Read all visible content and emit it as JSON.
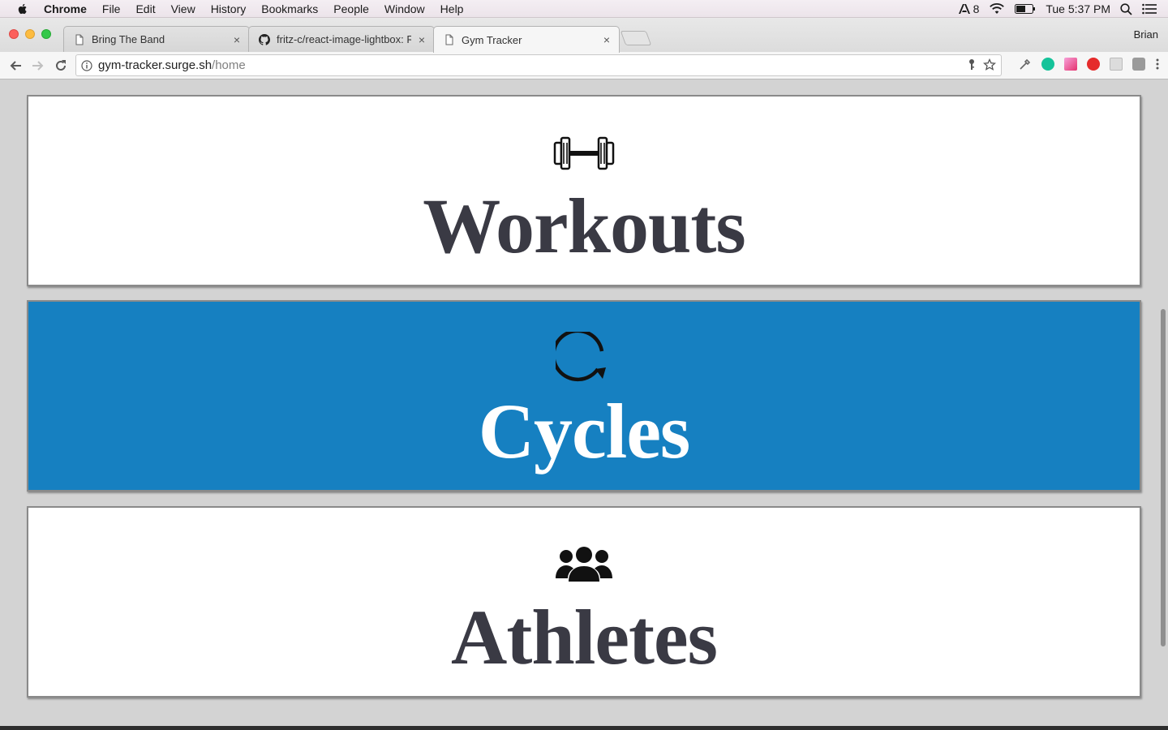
{
  "menubar": {
    "app_name": "Chrome",
    "items": [
      "File",
      "Edit",
      "View",
      "History",
      "Bookmarks",
      "People",
      "Window",
      "Help"
    ],
    "status": {
      "adobe_count": "8",
      "clock": "Tue 5:37 PM"
    }
  },
  "browser": {
    "profile_name": "Brian",
    "tabs": [
      {
        "title": "Bring The Band",
        "icon": "page-icon",
        "active": false
      },
      {
        "title": "fritz-c/react-image-lightbox: R",
        "icon": "github-icon",
        "active": false
      },
      {
        "title": "Gym Tracker",
        "icon": "page-icon",
        "active": true
      }
    ],
    "address": {
      "host": "gym-tracker.surge.sh",
      "path": "/home"
    }
  },
  "page": {
    "cards": [
      {
        "label": "Workouts",
        "icon": "dumbbell-icon",
        "selected": false
      },
      {
        "label": "Cycles",
        "icon": "cycle-icon",
        "selected": true
      },
      {
        "label": "Athletes",
        "icon": "group-icon",
        "selected": false
      }
    ],
    "selected_color": "#1680c1",
    "label_color": "#3a3a44"
  }
}
